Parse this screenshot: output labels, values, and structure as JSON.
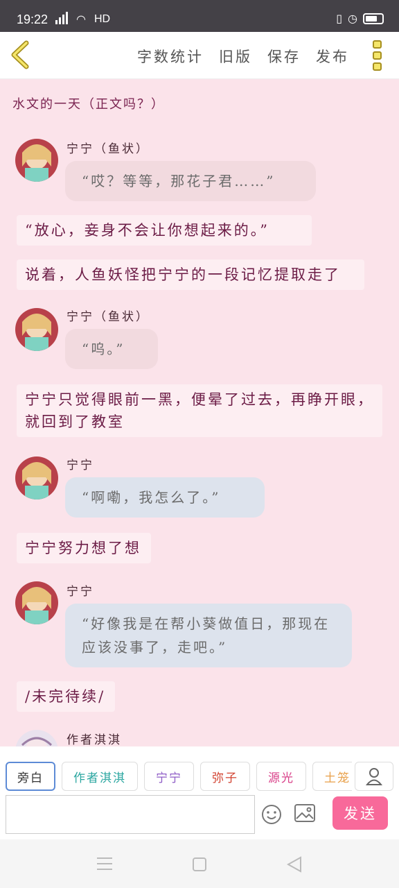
{
  "status": {
    "time": "19:22",
    "network": "4G",
    "hd": "HD"
  },
  "toolbar": {
    "word_count": "字数统计",
    "old_version": "旧版",
    "save": "保存",
    "publish": "发布"
  },
  "story_title": "水文的一天（正文吗？）",
  "messages": [
    {
      "type": "char",
      "name": "宁宁（鱼状）",
      "text": "“哎？等等，那花子君……”",
      "color": "pink"
    },
    {
      "type": "narration",
      "text": "“放心，妾身不会让你想起来的。”"
    },
    {
      "type": "narration",
      "text": "说着，人鱼妖怪把宁宁的一段记忆提取走了"
    },
    {
      "type": "char",
      "name": "宁宁（鱼状）",
      "text": "“呜。”",
      "color": "pink"
    },
    {
      "type": "narration",
      "text": "宁宁只觉得眼前一黑，便晕了过去，再睁开眼，就回到了教室"
    },
    {
      "type": "char",
      "name": "宁宁",
      "text": "“啊嘞，我怎么了。”",
      "color": "blue"
    },
    {
      "type": "narration",
      "text": "宁宁努力想了想"
    },
    {
      "type": "char",
      "name": "宁宁",
      "text": "“好像我是在帮小葵做值日，那现在应该没事了，走吧。”",
      "color": "blue"
    },
    {
      "type": "narration",
      "text": "/未完待续/"
    },
    {
      "type": "char",
      "name": "作者淇淇"
    }
  ],
  "chips": [
    {
      "label": "旁白",
      "color": "#333333"
    },
    {
      "label": "作者淇淇",
      "color": "#2aa6a0"
    },
    {
      "label": "宁宁",
      "color": "#8e5cc6"
    },
    {
      "label": "弥子",
      "color": "#d2412f"
    },
    {
      "label": "源光",
      "color": "#d9428a"
    },
    {
      "label": "土笼",
      "color": "#e8a04a"
    }
  ],
  "input": {
    "placeholder": ""
  },
  "send_label": "发送",
  "icons": [
    "back-chevron-icon",
    "more-menu-icon",
    "person-icon",
    "emoji-icon",
    "image-icon",
    "nav-menu-icon",
    "nav-home-icon",
    "nav-back-icon"
  ]
}
